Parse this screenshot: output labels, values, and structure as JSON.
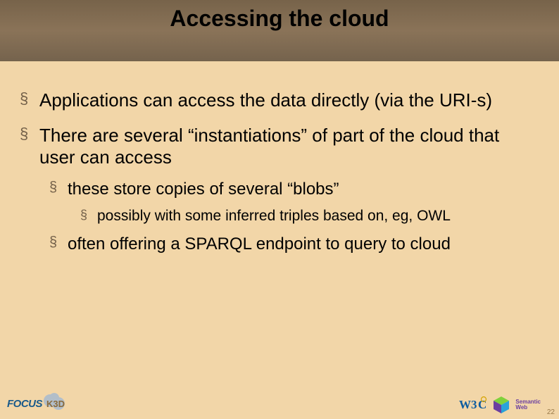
{
  "title": "Accessing the cloud",
  "bullets": {
    "a": "Applications can access the data directly (via the URI-s)",
    "b": "There are several “instantiations” of part of the cloud that user can access",
    "b1": "these store copies of several “blobs”",
    "b1a": "possibly with some inferred triples based on, eg, OWL",
    "b2": "often offering a SPARQL endpoint to query to cloud"
  },
  "footer": {
    "left_brand": "FOCUS",
    "left_sub": "K3D",
    "right_brand": "W3C",
    "right_sub1": "Semantic",
    "right_sub2": "Web",
    "page": "22"
  }
}
